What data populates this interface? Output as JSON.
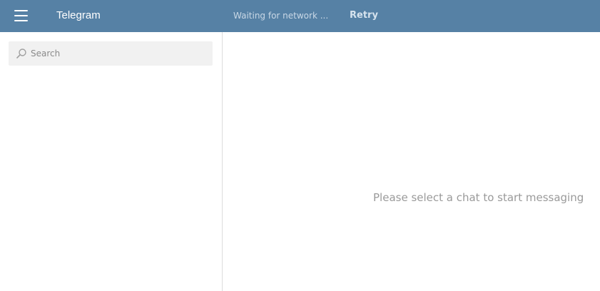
{
  "header": {
    "menu_icon": "hamburger-menu-icon",
    "title": "Telegram",
    "status_text": "Waiting for network ...",
    "retry_label": "Retry",
    "background_color": "#5681a5"
  },
  "sidebar": {
    "search": {
      "icon": "search-icon",
      "placeholder": "Search",
      "value": ""
    }
  },
  "main": {
    "empty_message": "Please select a chat to start messaging"
  }
}
